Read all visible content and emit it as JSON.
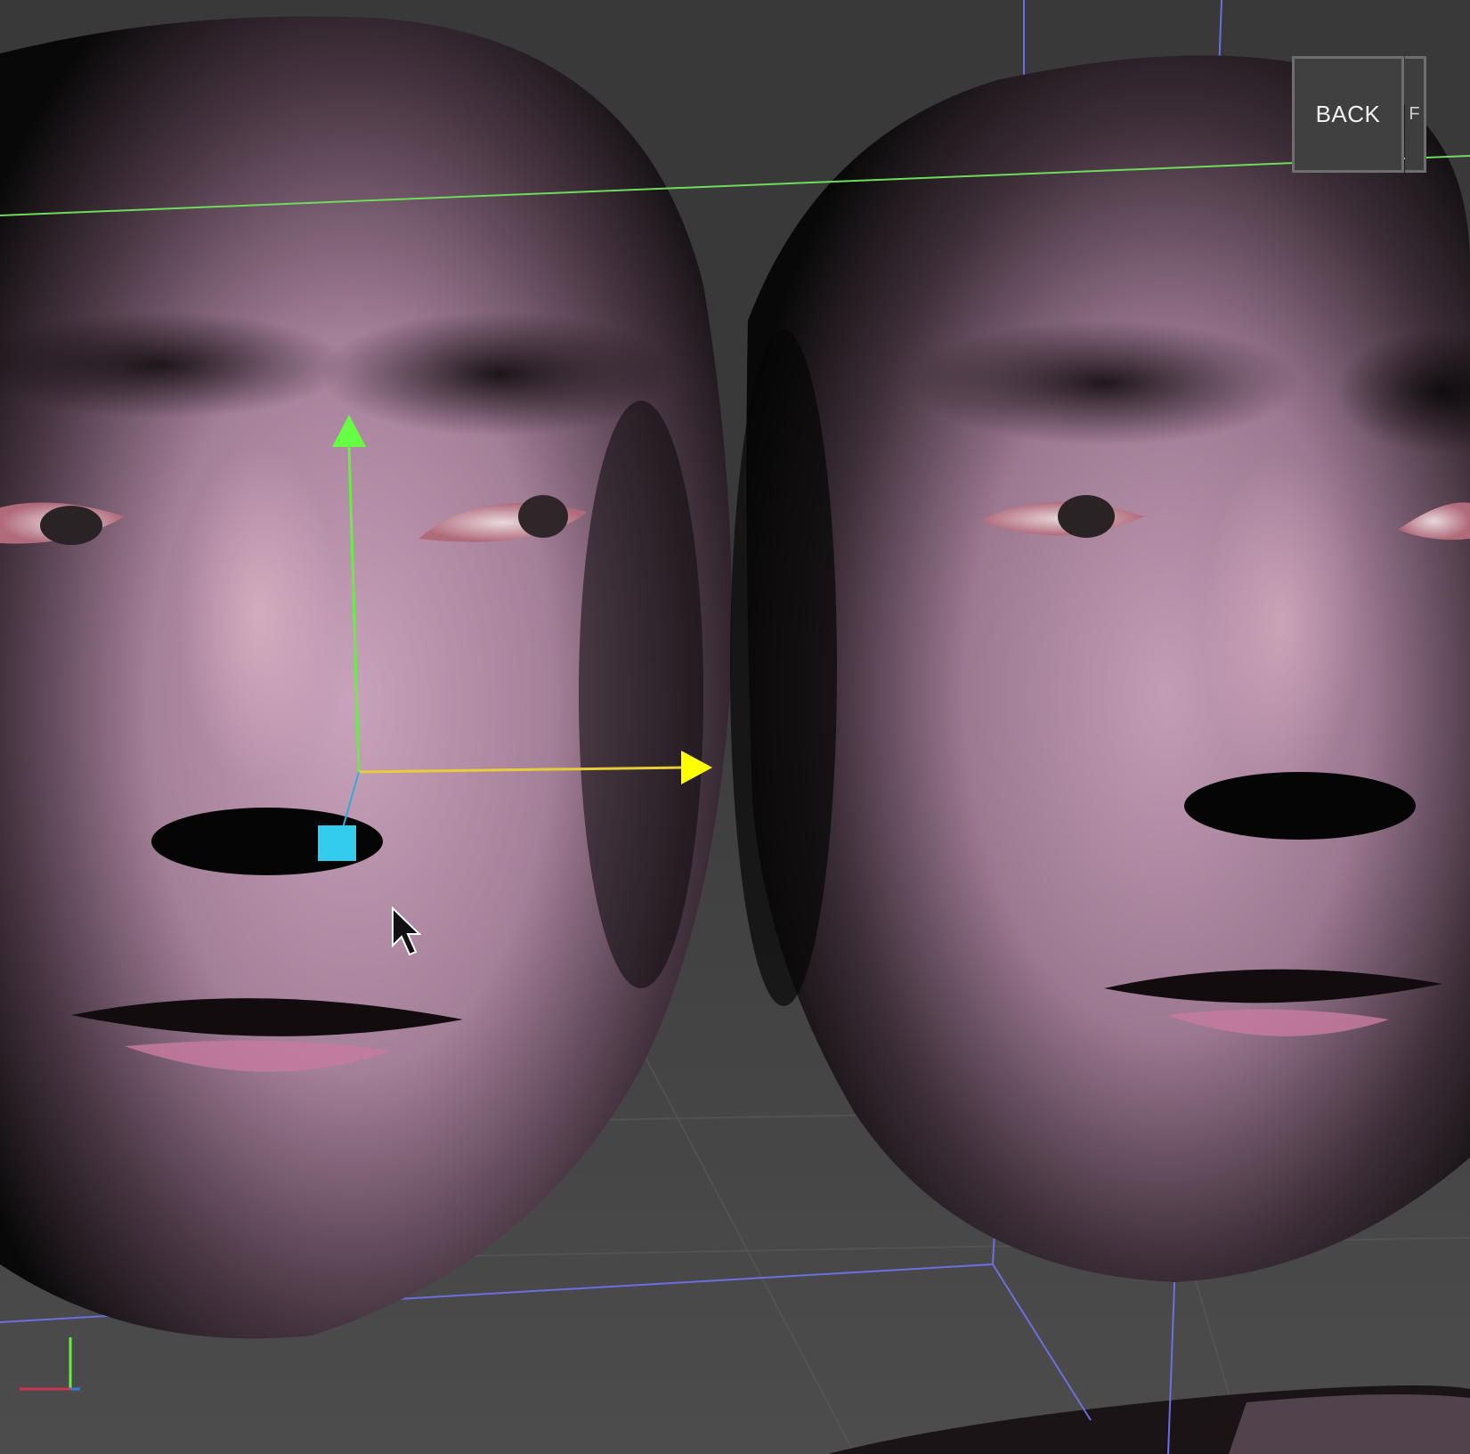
{
  "toolbar": {
    "back_label": "BACK",
    "next_tab_label": "F"
  },
  "colors": {
    "background": "#3a3a3a",
    "floor": "#4a4a4a",
    "skin_light": "#c29bb4",
    "skin_dark": "#0a0a0a",
    "lips": "#c47a9e",
    "axis_x": "#ffff00",
    "axis_y": "#66ff44",
    "axis_z": "#33ccee",
    "grid_green": "#6edc5a",
    "grid_blue": "#6b6fe0"
  },
  "viewport": {
    "objects": [
      "face-mesh-left",
      "face-mesh-right"
    ],
    "gizmo": "translate-gizmo",
    "cursor": "mouse-cursor-icon"
  }
}
